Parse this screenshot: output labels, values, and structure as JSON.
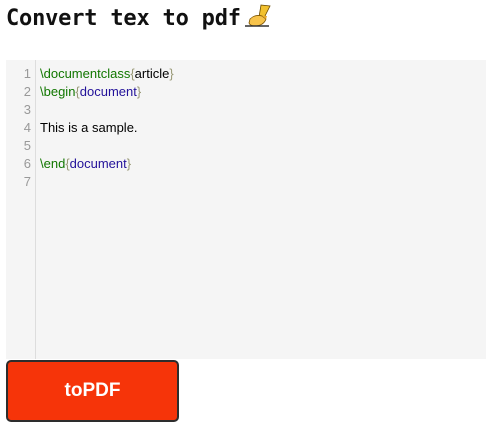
{
  "page": {
    "title": "Convert tex to pdf",
    "title_icon": "writing-hand-icon"
  },
  "editor": {
    "line_numbers": [
      "1",
      "2",
      "3",
      "4",
      "5",
      "6",
      "7"
    ],
    "lines": [
      {
        "keyword": "\\documentclass",
        "open": "{",
        "arg": "article",
        "close": "}",
        "plain": ""
      },
      {
        "keyword": "\\begin",
        "open": "{",
        "arg": "document",
        "close": "}",
        "plain": ""
      },
      {
        "keyword": "",
        "open": "",
        "arg": "",
        "close": "",
        "plain": ""
      },
      {
        "keyword": "",
        "open": "",
        "arg": "",
        "close": "",
        "plain": "This is a sample."
      },
      {
        "keyword": "",
        "open": "",
        "arg": "",
        "close": "",
        "plain": ""
      },
      {
        "keyword": "\\end",
        "open": "{",
        "arg": "document",
        "close": "}",
        "plain": ""
      },
      {
        "keyword": "",
        "open": "",
        "arg": "",
        "close": "",
        "plain": ""
      }
    ],
    "colors": {
      "keyword": "#117700",
      "bracket": "#999977",
      "argument": "#221199",
      "background": "#f5f5f5",
      "gutter_text": "#999999"
    }
  },
  "actions": {
    "convert_label": "toPDF",
    "convert_color": "#f63409"
  }
}
